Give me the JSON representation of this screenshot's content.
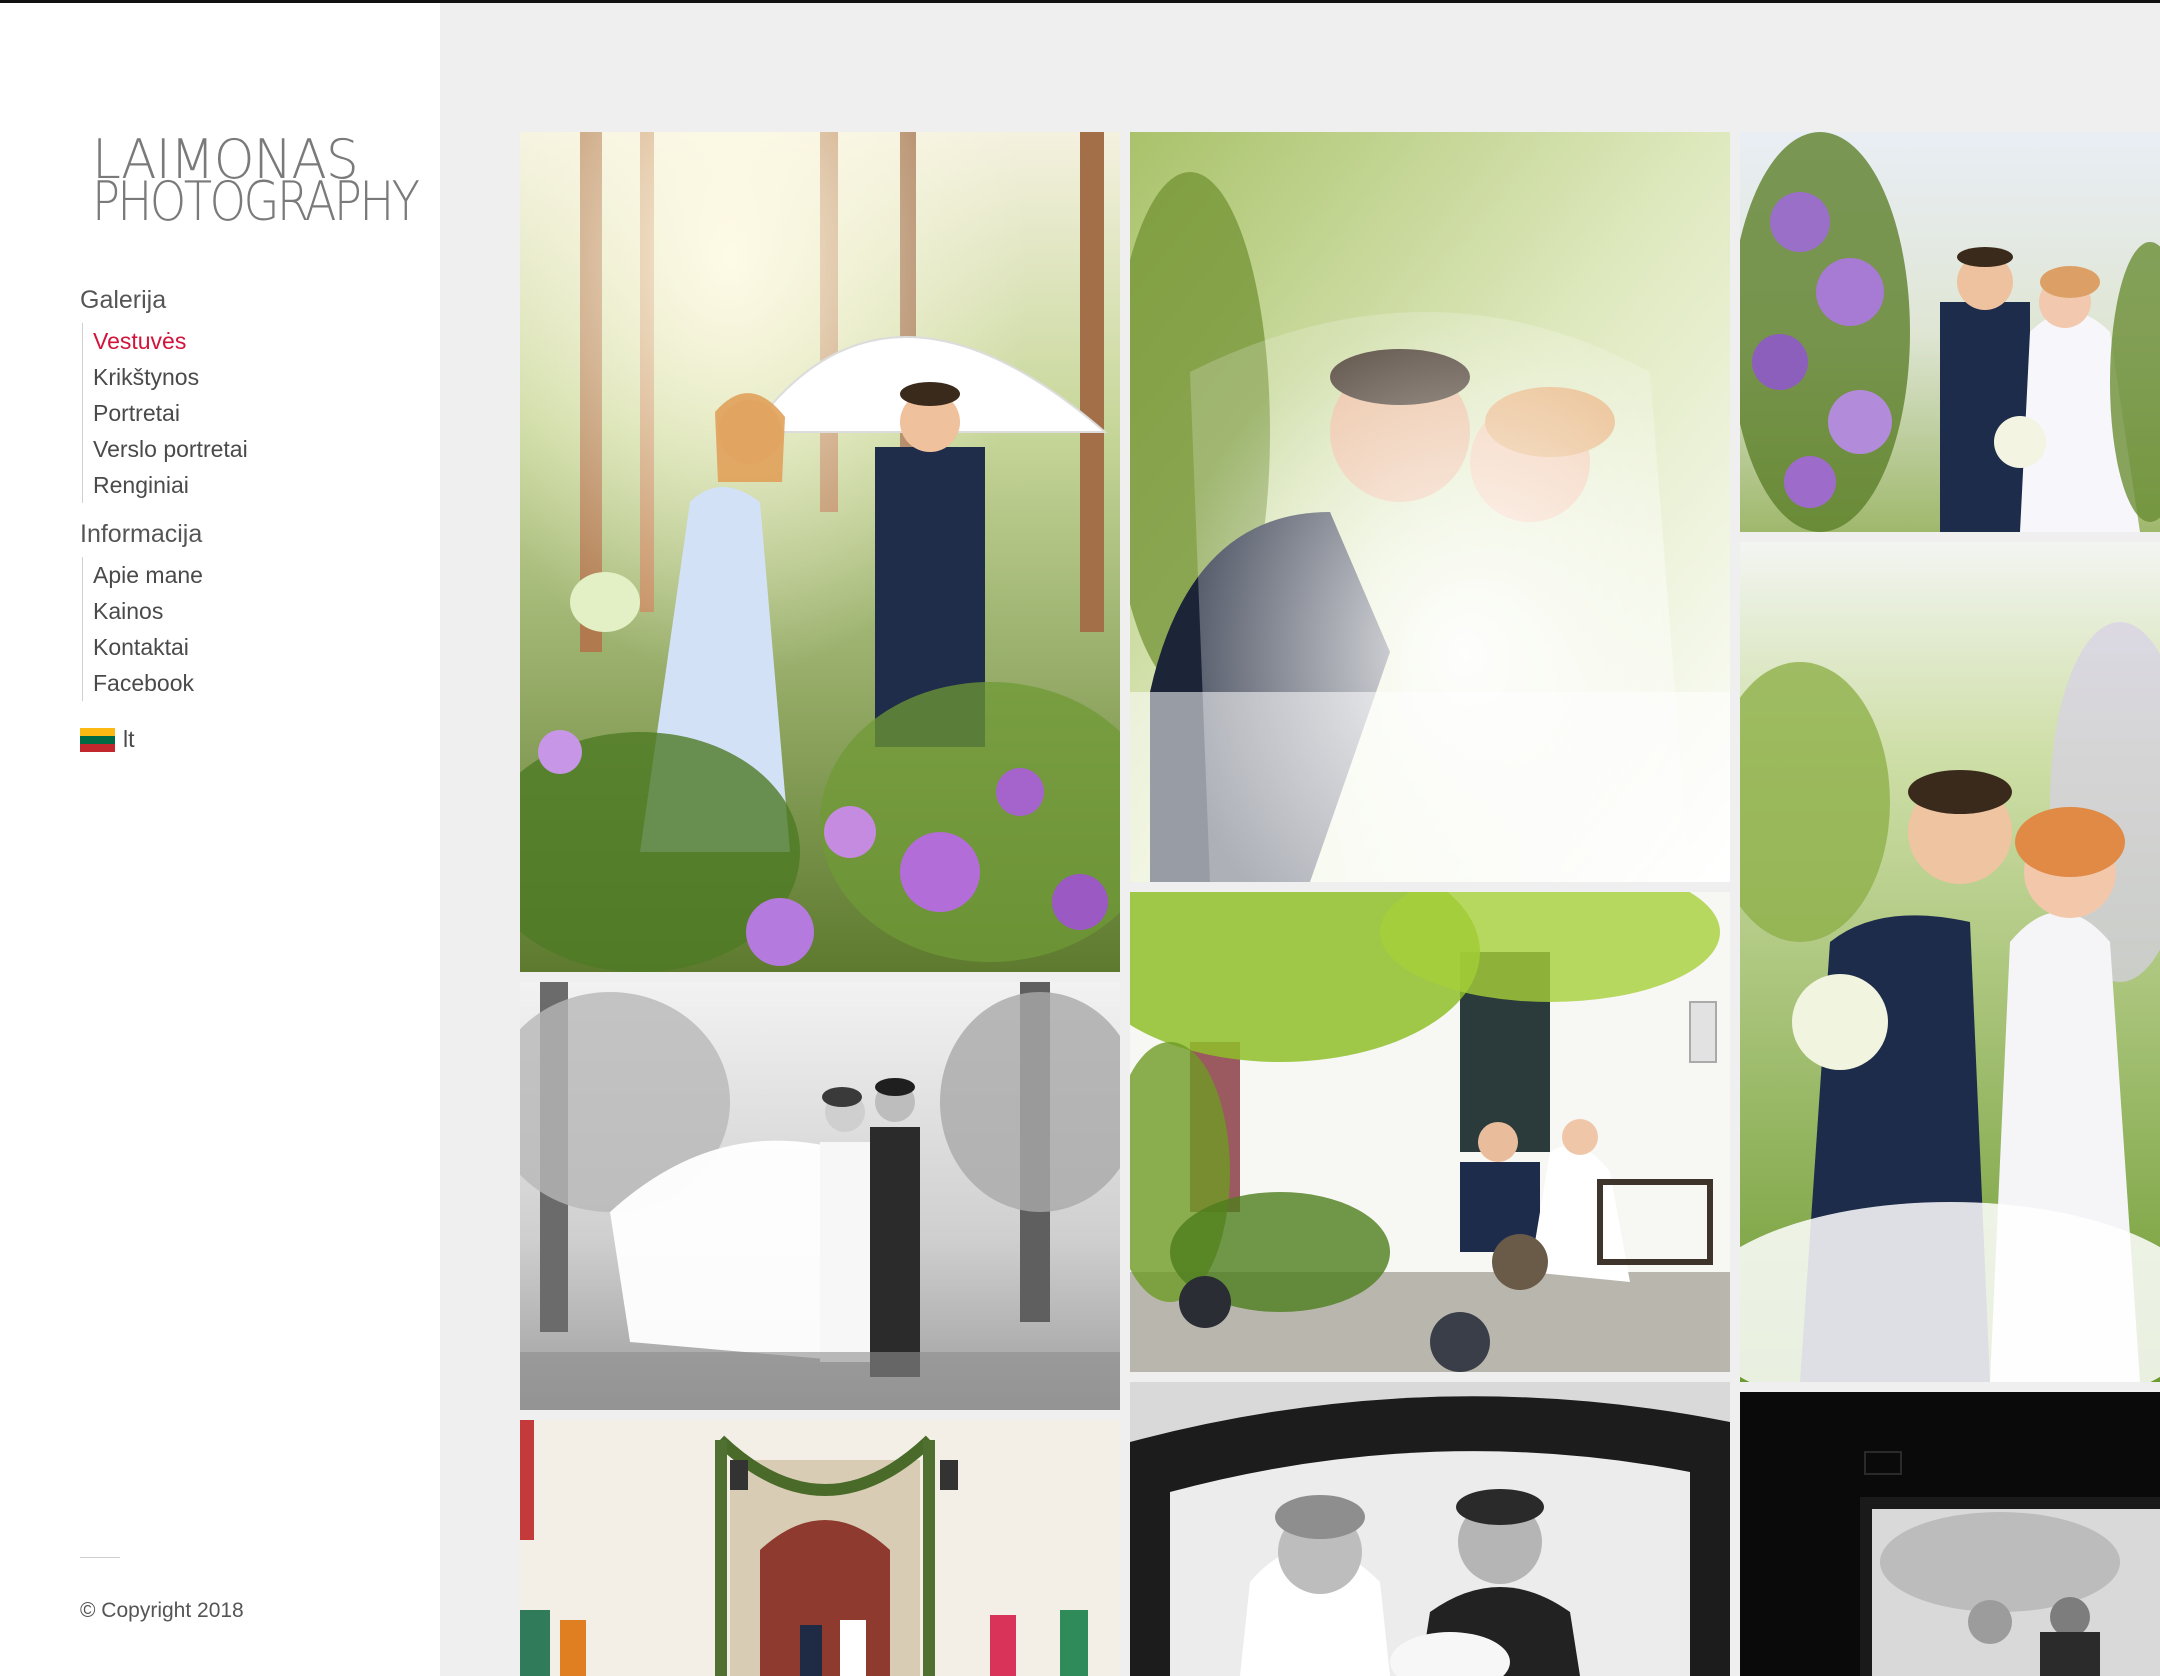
{
  "logo": {
    "line1": "LAIMONAS",
    "line2": "PHOTOGRAPHY"
  },
  "nav": {
    "gallery_heading": "Galerija",
    "gallery_items": [
      {
        "label": "Vestuvės",
        "active": true
      },
      {
        "label": "Krikštynos"
      },
      {
        "label": "Portretai"
      },
      {
        "label": "Verslo portretai"
      },
      {
        "label": "Renginiai"
      }
    ],
    "info_heading": "Informacija",
    "info_items": [
      {
        "label": "Apie mane"
      },
      {
        "label": "Kainos"
      },
      {
        "label": "Kontaktai"
      },
      {
        "label": "Facebook"
      }
    ]
  },
  "language": {
    "label": "lt",
    "flag_icon": "lithuania-flag-icon",
    "flag_colors": [
      "#fdb913",
      "#006a44",
      "#c1272d"
    ]
  },
  "footer": {
    "copyright": "© Copyright 2018"
  },
  "colors": {
    "accent": "#d2143a",
    "sidebar_bg": "#ffffff",
    "gallery_bg": "#efefef"
  },
  "gallery": [
    {
      "id": "photo-1",
      "scene": "Couple with white umbrella in forest, purple flowers foreground"
    },
    {
      "id": "photo-2",
      "scene": "Couple embracing under bridal veil"
    },
    {
      "id": "photo-3",
      "scene": "Couple among lilac bushes"
    },
    {
      "id": "photo-4",
      "scene": "Black and white couple with flowing veil in park"
    },
    {
      "id": "photo-5",
      "scene": "Couple sitting on bench beside white house"
    },
    {
      "id": "photo-6",
      "scene": "Couple portrait with lilacs, groom holding bouquet"
    },
    {
      "id": "photo-7",
      "scene": "Church entrance with confetti and guests"
    },
    {
      "id": "photo-8",
      "scene": "Black and white couple inside car"
    },
    {
      "id": "photo-9",
      "scene": "Dark doorway silhouette"
    }
  ]
}
